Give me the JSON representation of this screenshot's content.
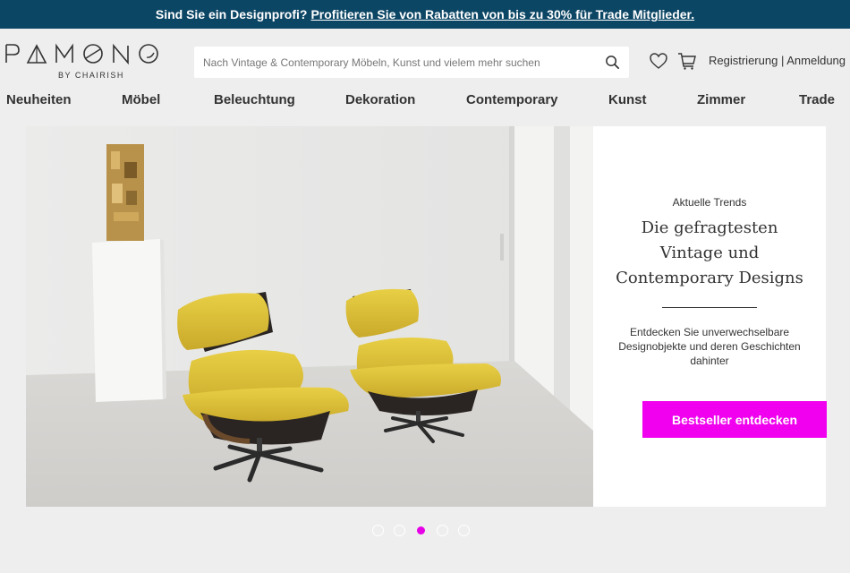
{
  "promo": {
    "text": "Sind Sie ein Designprofi?",
    "link": "Profitieren Sie von Rabatten von bis zu 30% für Trade Mitglieder."
  },
  "logo": {
    "letters": [
      "P",
      "A",
      "M",
      "O",
      "N",
      "O"
    ],
    "sub": "BY CHAIRISH"
  },
  "search": {
    "placeholder": "Nach Vintage & Contemporary Möbeln, Kunst und vielem mehr suchen",
    "icon": "search-icon"
  },
  "header": {
    "wishlist_icon": "heart-icon",
    "cart_icon": "cart-icon",
    "register": "Registrierung",
    "separator": "|",
    "login": "Anmeldung"
  },
  "nav": [
    "Neuheiten",
    "Möbel",
    "Beleuchtung",
    "Dekoration",
    "Contemporary",
    "Kunst",
    "Zimmer",
    "Trade"
  ],
  "hero": {
    "kicker": "Aktuelle Trends",
    "headline": "Die gefragtesten Vintage und Contemporary Designs",
    "description": "Entdecken Sie unverwechselbare Designobjekte und deren Geschichten dahinter",
    "cta": "Bestseller entdecken"
  },
  "carousel": {
    "count": 5,
    "active_index": 2
  },
  "colors": {
    "promo_bg": "#0c4665",
    "accent": "#f000ee",
    "page_bg": "#eeeeee"
  }
}
